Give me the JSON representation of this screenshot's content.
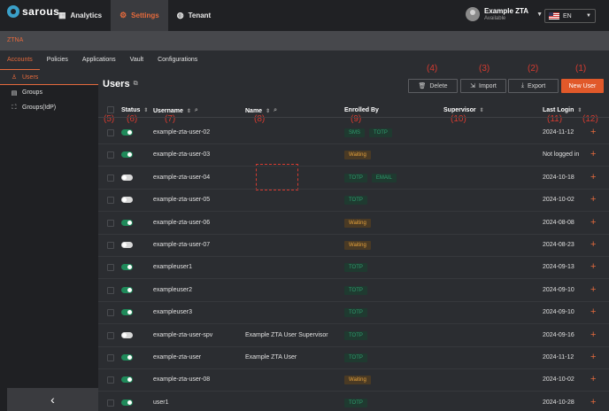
{
  "header": {
    "logo_text": "sarous",
    "nav": [
      {
        "label": "Analytics",
        "icon": "chart-icon"
      },
      {
        "label": "Settings",
        "icon": "gear-icon"
      },
      {
        "label": "Tenant",
        "icon": "globe-icon"
      }
    ],
    "user": {
      "name": "Example ZTA",
      "status": "Available"
    },
    "language": "EN"
  },
  "section_label": "ZTNA",
  "tabs": [
    "Accounts",
    "Policies",
    "Applications",
    "Vault",
    "Configurations"
  ],
  "sidebar": {
    "items": [
      {
        "label": "Users",
        "icon": "user-icon"
      },
      {
        "label": "Groups",
        "icon": "grid-icon"
      },
      {
        "label": "Groups(IdP)",
        "icon": "group-idp-icon"
      }
    ]
  },
  "page": {
    "title": "Users",
    "buttons": {
      "delete": "Delete",
      "import": "Import",
      "export": "Export",
      "new_user": "New User"
    }
  },
  "annotations": [
    "(1)",
    "(2)",
    "(3)",
    "(4)",
    "(5)",
    "(6)",
    "(7)",
    "(8)",
    "(9)",
    "(10)",
    "(11)",
    "(12)"
  ],
  "table": {
    "columns": {
      "status": "Status",
      "username": "Username",
      "name": "Name",
      "enrolled_by": "Enrolled By",
      "supervisor": "Supervisor",
      "last_login": "Last Login"
    },
    "rows": [
      {
        "enabled": true,
        "username": "example-zta-user-02",
        "name": "",
        "enrolled": [
          "SMS",
          "TOTP"
        ],
        "last_login": "2024-11-12"
      },
      {
        "enabled": true,
        "username": "example-zta-user-03",
        "name": "",
        "enrolled": [
          "Waiting"
        ],
        "last_login": "Not logged in"
      },
      {
        "enabled": false,
        "username": "example-zta-user-04",
        "name": "",
        "enrolled": [
          "TOTP",
          "EMAIL"
        ],
        "last_login": "2024-10-18"
      },
      {
        "enabled": false,
        "username": "example-zta-user-05",
        "name": "",
        "enrolled": [
          "TOTP"
        ],
        "last_login": "2024-10-02"
      },
      {
        "enabled": true,
        "username": "example-zta-user-06",
        "name": "",
        "enrolled": [
          "Waiting"
        ],
        "last_login": "2024-08-08"
      },
      {
        "enabled": false,
        "username": "example-zta-user-07",
        "name": "",
        "enrolled": [
          "Waiting"
        ],
        "last_login": "2024-08-23"
      },
      {
        "enabled": true,
        "username": "exampleuser1",
        "name": "",
        "enrolled": [
          "TOTP"
        ],
        "last_login": "2024-09-13"
      },
      {
        "enabled": true,
        "username": "exampleuser2",
        "name": "",
        "enrolled": [
          "TOTP"
        ],
        "last_login": "2024-09-10"
      },
      {
        "enabled": true,
        "username": "exampleuser3",
        "name": "",
        "enrolled": [
          "TOTP"
        ],
        "last_login": "2024-09-10"
      },
      {
        "enabled": false,
        "username": "example-zta-user-spv",
        "name": "Example ZTA User Supervisor",
        "enrolled": [
          "TOTP"
        ],
        "last_login": "2024-09-16"
      },
      {
        "enabled": true,
        "username": "example-zta-user",
        "name": "Example ZTA User",
        "enrolled": [
          "TOTP"
        ],
        "last_login": "2024-11-12"
      },
      {
        "enabled": true,
        "username": "example-zta-user-08",
        "name": "",
        "enrolled": [
          "Waiting"
        ],
        "last_login": "2024-10-02"
      },
      {
        "enabled": true,
        "username": "user1",
        "name": "",
        "enrolled": [
          "TOTP"
        ],
        "last_login": "2024-10-28"
      }
    ],
    "add_symbol": "+"
  },
  "colors": {
    "accent": "#e56a3c",
    "success": "#2e9d6e",
    "warning": "#e5a23c",
    "annotation": "#d63b30"
  }
}
